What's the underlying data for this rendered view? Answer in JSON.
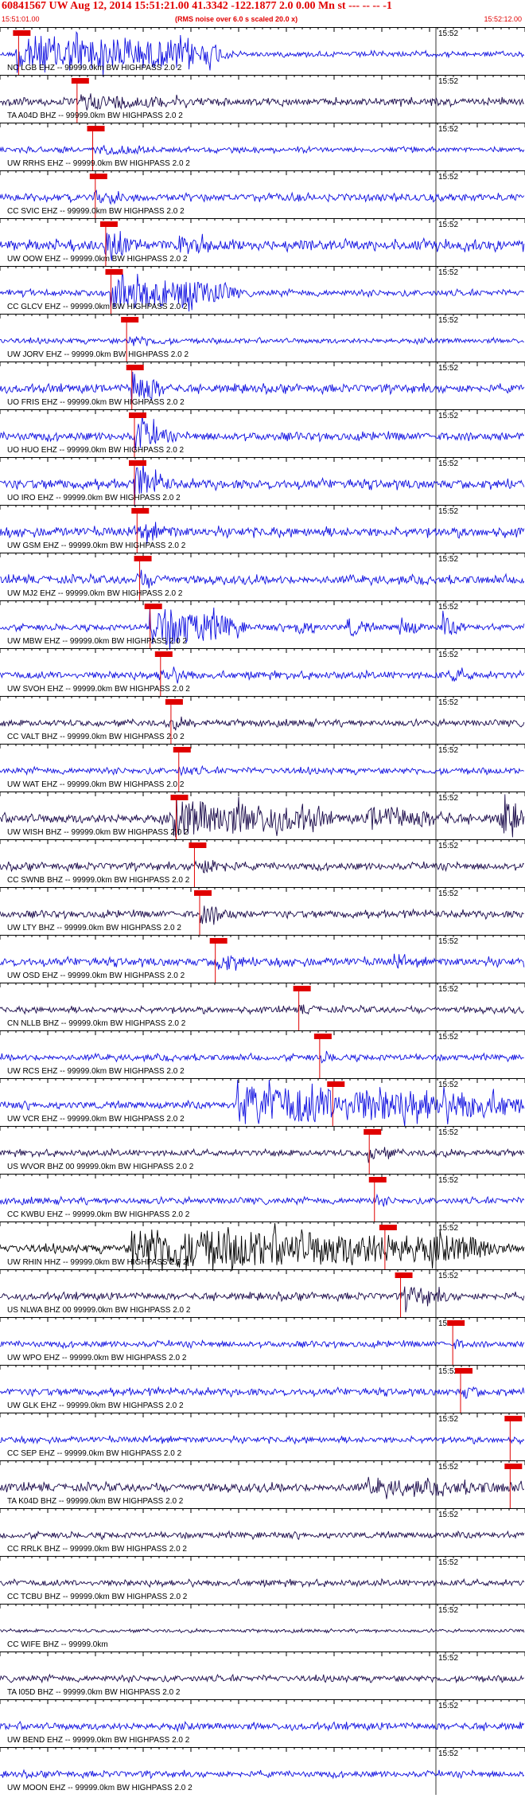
{
  "header": {
    "title": "60841567 UW Aug 12, 2014 15:51:21.00   41.3342 -122.1877  2.0 0.00 Mn st --- -- --   -1",
    "time_left": "15:51:01.00",
    "rms_note": "(RMS noise over 6.0 s scaled 20.0 x)",
    "time_right": "15:52:12.00"
  },
  "chart_data": {
    "type": "line",
    "title": "60841567 UW Aug 12, 2014 15:51:21.00   41.3342 -122.1877  2.0 0.00 Mn st --- -- --   -1",
    "x_start": "15:51:01.00",
    "x_end": "15:52:12.00",
    "minute_label": "15:52",
    "colors": {
      "blue": "#1010e0",
      "dark": "#1a0a4a",
      "black": "#000000",
      "pick": "#e00000"
    },
    "stations": [
      {
        "label": "NC LGB EHZ -- 99999.0km BW  HIGHPASS  2.0  2",
        "color": "blue",
        "pick": 0.28,
        "amp": 0.25,
        "bursts": [
          {
            "t0": 0.3,
            "t1": 4.0,
            "a": 2.3
          }
        ]
      },
      {
        "label": "TA A04D BHZ -- 99999.0km BW  HIGHPASS  2.0  2",
        "color": "dark",
        "pick": 1.4,
        "amp": 0.35,
        "bursts": [
          {
            "t0": 1.5,
            "t1": 3.5,
            "a": 0.9
          }
        ]
      },
      {
        "label": "UW RRHS EHZ -- 99999.0km BW  HIGHPASS  2.0  2",
        "color": "blue",
        "pick": 1.7,
        "amp": 0.25,
        "bursts": [
          {
            "t0": 1.8,
            "t1": 3.0,
            "a": 0.6
          }
        ]
      },
      {
        "label": "CC SVIC EHZ -- 99999.0km BW  HIGHPASS  2.0  2",
        "color": "blue",
        "pick": 1.75,
        "amp": 0.35,
        "bursts": [
          {
            "t0": 1.8,
            "t1": 2.6,
            "a": 0.7
          }
        ]
      },
      {
        "label": "UW OOW EHZ -- 99999.0km BW  HIGHPASS  2.0  2",
        "color": "blue",
        "pick": 1.95,
        "amp": 0.5,
        "bursts": [
          {
            "t0": 2.0,
            "t1": 2.4,
            "a": 1.6
          },
          {
            "t0": 3.4,
            "t1": 4.1,
            "a": 1.2
          }
        ]
      },
      {
        "label": "CC GLCV EHZ -- 99999.0km BW  HIGHPASS  2.0  2",
        "color": "blue",
        "pick": 2.05,
        "amp": 0.3,
        "bursts": [
          {
            "t0": 2.1,
            "t1": 4.2,
            "a": 2.0
          }
        ]
      },
      {
        "label": "UW JORV EHZ -- 99999.0km BW  HIGHPASS  2.0  2",
        "color": "blue",
        "pick": 2.35,
        "amp": 0.25,
        "bursts": [
          {
            "t0": 2.4,
            "t1": 3.2,
            "a": 0.6
          }
        ]
      },
      {
        "label": "UO FRIS EHZ -- 99999.0km BW  HIGHPASS  2.0  2",
        "color": "blue",
        "pick": 2.45,
        "amp": 0.4,
        "bursts": [
          {
            "t0": 2.5,
            "t1": 2.9,
            "a": 2.2
          }
        ]
      },
      {
        "label": "UO HUO EHZ -- 99999.0km BW  HIGHPASS  2.0  2",
        "color": "blue",
        "pick": 2.5,
        "amp": 0.4,
        "bursts": [
          {
            "t0": 2.55,
            "t1": 2.95,
            "a": 2.2
          }
        ]
      },
      {
        "label": "UO IRO EHZ -- 99999.0km BW  HIGHPASS  2.0  2",
        "color": "blue",
        "pick": 2.5,
        "amp": 0.45,
        "bursts": [
          {
            "t0": 2.55,
            "t1": 3.0,
            "a": 2.0
          }
        ]
      },
      {
        "label": "UW GSM EHZ -- 99999.0km BW  HIGHPASS  2.0  2",
        "color": "blue",
        "pick": 2.55,
        "amp": 0.45,
        "bursts": [
          {
            "t0": 2.6,
            "t1": 3.4,
            "a": 1.0
          }
        ]
      },
      {
        "label": "UW MJ2 EHZ -- 99999.0km BW  HIGHPASS  2.0  2",
        "color": "blue",
        "pick": 2.6,
        "amp": 0.4,
        "bursts": [
          {
            "t0": 2.6,
            "t1": 3.2,
            "a": 0.9
          }
        ]
      },
      {
        "label": "UW MBW EHZ -- 99999.0km BW  HIGHPASS  2.0  2",
        "color": "blue",
        "pick": 2.8,
        "amp": 0.3,
        "bursts": [
          {
            "t0": 2.85,
            "t1": 4.3,
            "a": 2.4
          },
          {
            "t0": 5.6,
            "t1": 5.8,
            "a": 1.4
          },
          {
            "t0": 6.6,
            "t1": 6.8,
            "a": 1.4
          },
          {
            "t0": 7.6,
            "t1": 7.8,
            "a": 1.4
          },
          {
            "t0": 8.4,
            "t1": 8.6,
            "a": 1.4
          }
        ]
      },
      {
        "label": "UW SVOH EHZ -- 99999.0km BW  HIGHPASS  2.0  2",
        "color": "blue",
        "pick": 3.0,
        "amp": 0.35,
        "bursts": [
          {
            "t0": 3.0,
            "t1": 3.6,
            "a": 0.9
          },
          {
            "t0": 8.6,
            "t1": 9.0,
            "a": 0.8
          }
        ]
      },
      {
        "label": "CC VALT BHZ -- 99999.0km BW  HIGHPASS  2.0  2",
        "color": "dark",
        "pick": 3.2,
        "amp": 0.3,
        "bursts": [
          {
            "t0": 3.2,
            "t1": 3.8,
            "a": 0.6
          }
        ]
      },
      {
        "label": "UW WAT EHZ -- 99999.0km BW  HIGHPASS  2.0  2",
        "color": "blue",
        "pick": 3.35,
        "amp": 0.3,
        "bursts": [
          {
            "t0": 3.4,
            "t1": 3.9,
            "a": 0.6
          }
        ]
      },
      {
        "label": "UW WISH BHZ -- 99999.0km BW  HIGHPASS  2.0  2",
        "color": "dark",
        "pick": 3.3,
        "amp": 0.45,
        "bursts": [
          {
            "t0": 3.3,
            "t1": 6.0,
            "a": 2.2
          },
          {
            "t0": 7.0,
            "t1": 8.5,
            "a": 1.4
          },
          {
            "t0": 9.5,
            "t1": 9.9,
            "a": 2.2
          }
        ]
      },
      {
        "label": "CC SWNB BHZ -- 99999.0km BW  HIGHPASS  2.0  2",
        "color": "dark",
        "pick": 3.65,
        "amp": 0.35,
        "bursts": [
          {
            "t0": 3.7,
            "t1": 4.4,
            "a": 1.0
          }
        ]
      },
      {
        "label": "UW LTY BHZ -- 99999.0km BW  HIGHPASS  2.0  2",
        "color": "dark",
        "pick": 3.75,
        "amp": 0.35,
        "bursts": [
          {
            "t0": 3.8,
            "t1": 4.3,
            "a": 1.2
          }
        ]
      },
      {
        "label": "UW OSD EHZ -- 99999.0km BW  HIGHPASS  2.0  2",
        "color": "blue",
        "pick": 4.05,
        "amp": 0.4,
        "bursts": [
          {
            "t0": 4.1,
            "t1": 4.5,
            "a": 1.3
          },
          {
            "t0": 7.5,
            "t1": 7.6,
            "a": 1.3
          }
        ]
      },
      {
        "label": "CN NLLB BHZ -- 99999.0km BW  HIGHPASS  2.0  2",
        "color": "dark",
        "pick": 5.65,
        "amp": 0.3,
        "bursts": [
          {
            "t0": 5.7,
            "t1": 6.2,
            "a": 0.6
          }
        ]
      },
      {
        "label": "UW RCS EHZ -- 99999.0km BW  HIGHPASS  2.0  2",
        "color": "blue",
        "pick": 6.05,
        "amp": 0.3,
        "bursts": [
          {
            "t0": 6.1,
            "t1": 6.6,
            "a": 0.6
          }
        ]
      },
      {
        "label": "UW VCR EHZ -- 99999.0km BW  HIGHPASS  2.0  2",
        "color": "blue",
        "pick": 6.3,
        "amp": 0.35,
        "bursts": [
          {
            "t0": 4.5,
            "t1": 9.6,
            "a": 2.3
          }
        ]
      },
      {
        "label": "US WVOR BHZ 00 99999.0km BW  HIGHPASS  2.0  2",
        "color": "dark",
        "pick": 7.0,
        "amp": 0.3,
        "bursts": [
          {
            "t0": 7.0,
            "t1": 7.4,
            "a": 0.9
          }
        ]
      },
      {
        "label": "CC KWBU EHZ -- 99999.0km BW  HIGHPASS  2.0  2",
        "color": "blue",
        "pick": 7.1,
        "amp": 0.3,
        "bursts": [
          {
            "t0": 7.1,
            "t1": 7.5,
            "a": 0.6
          }
        ]
      },
      {
        "label": "UW RHIN HHZ -- 99999.0km BW  HIGHPASS  2.0  2",
        "color": "black",
        "pick": 7.3,
        "amp": 0.4,
        "bursts": [
          {
            "t0": 2.5,
            "t1": 9.2,
            "a": 2.4
          }
        ]
      },
      {
        "label": "US NLWA BHZ 00 99999.0km BW  HIGHPASS  2.0  2",
        "color": "dark",
        "pick": 7.6,
        "amp": 0.35,
        "bursts": [
          {
            "t0": 7.7,
            "t1": 8.4,
            "a": 1.2
          }
        ]
      },
      {
        "label": "UW WPO EHZ -- 99999.0km BW  HIGHPASS  2.0  2",
        "color": "blue",
        "pick": 8.6,
        "amp": 0.3,
        "bursts": [
          {
            "t0": 8.65,
            "t1": 8.9,
            "a": 0.6
          }
        ]
      },
      {
        "label": "UW GLK EHZ -- 99999.0km BW  HIGHPASS  2.0  2",
        "color": "blue",
        "pick": 8.75,
        "amp": 0.35,
        "bursts": [
          {
            "t0": 8.8,
            "t1": 9.1,
            "a": 0.9
          }
        ]
      },
      {
        "label": "CC SEP EHZ -- 99999.0km BW  HIGHPASS  2.0  2",
        "color": "blue",
        "pick": 9.7,
        "amp": 0.3,
        "bursts": []
      },
      {
        "label": "TA K04D BHZ -- 99999.0km BW  HIGHPASS  2.0  2",
        "color": "dark",
        "pick": 9.7,
        "amp": 0.4,
        "bursts": [
          {
            "t0": 7.0,
            "t1": 9.9,
            "a": 0.9
          }
        ]
      },
      {
        "label": "CC RRLK BHZ -- 99999.0km BW  HIGHPASS  2.0  2",
        "color": "dark",
        "pick": null,
        "amp": 0.3,
        "bursts": []
      },
      {
        "label": "CC TCBU BHZ -- 99999.0km BW  HIGHPASS  2.0  2",
        "color": "dark",
        "pick": null,
        "amp": 0.3,
        "bursts": []
      },
      {
        "label": "CC WIFE BHZ -- 99999.0km",
        "color": "dark",
        "pick": null,
        "amp": 0.15,
        "bursts": []
      },
      {
        "label": "TA I05D BHZ -- 99999.0km BW  HIGHPASS  2.0  2",
        "color": "dark",
        "pick": null,
        "amp": 0.3,
        "bursts": []
      },
      {
        "label": "UW BEND EHZ -- 99999.0km BW  HIGHPASS  2.0  2",
        "color": "blue",
        "pick": null,
        "amp": 0.35,
        "bursts": []
      },
      {
        "label": "UW MOON EHZ -- 99999.0km BW  HIGHPASS  2.0  2",
        "color": "blue",
        "pick": null,
        "amp": 0.3,
        "bursts": []
      }
    ]
  }
}
